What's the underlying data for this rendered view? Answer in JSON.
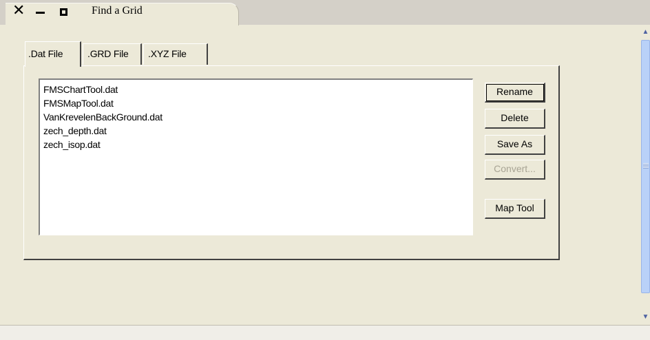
{
  "window": {
    "title": "Find a Grid",
    "controls": {
      "close": "✕",
      "minimize": "minimize",
      "maximize": "maximize"
    }
  },
  "tabs": [
    {
      "label": ".Dat File",
      "selected": true
    },
    {
      "label": ".GRD File",
      "selected": false
    },
    {
      "label": ".XYZ File",
      "selected": false
    }
  ],
  "file_list": {
    "items": [
      "FMSChartTool.dat",
      "FMSMapTool.dat",
      "VanKrevelenBackGround.dat",
      "zech_depth.dat",
      "zech_isop.dat"
    ]
  },
  "buttons": {
    "rename": "Rename",
    "delete": "Delete",
    "save_as": "Save As",
    "convert": "Convert...",
    "map_tool": "Map Tool"
  },
  "scrollbar": {
    "up_icon": "▲",
    "down_icon": "▼"
  },
  "colors": {
    "background": "#ece9d8",
    "scroll_thumb": "#b9d1f8",
    "disabled_text": "#a8a494"
  }
}
